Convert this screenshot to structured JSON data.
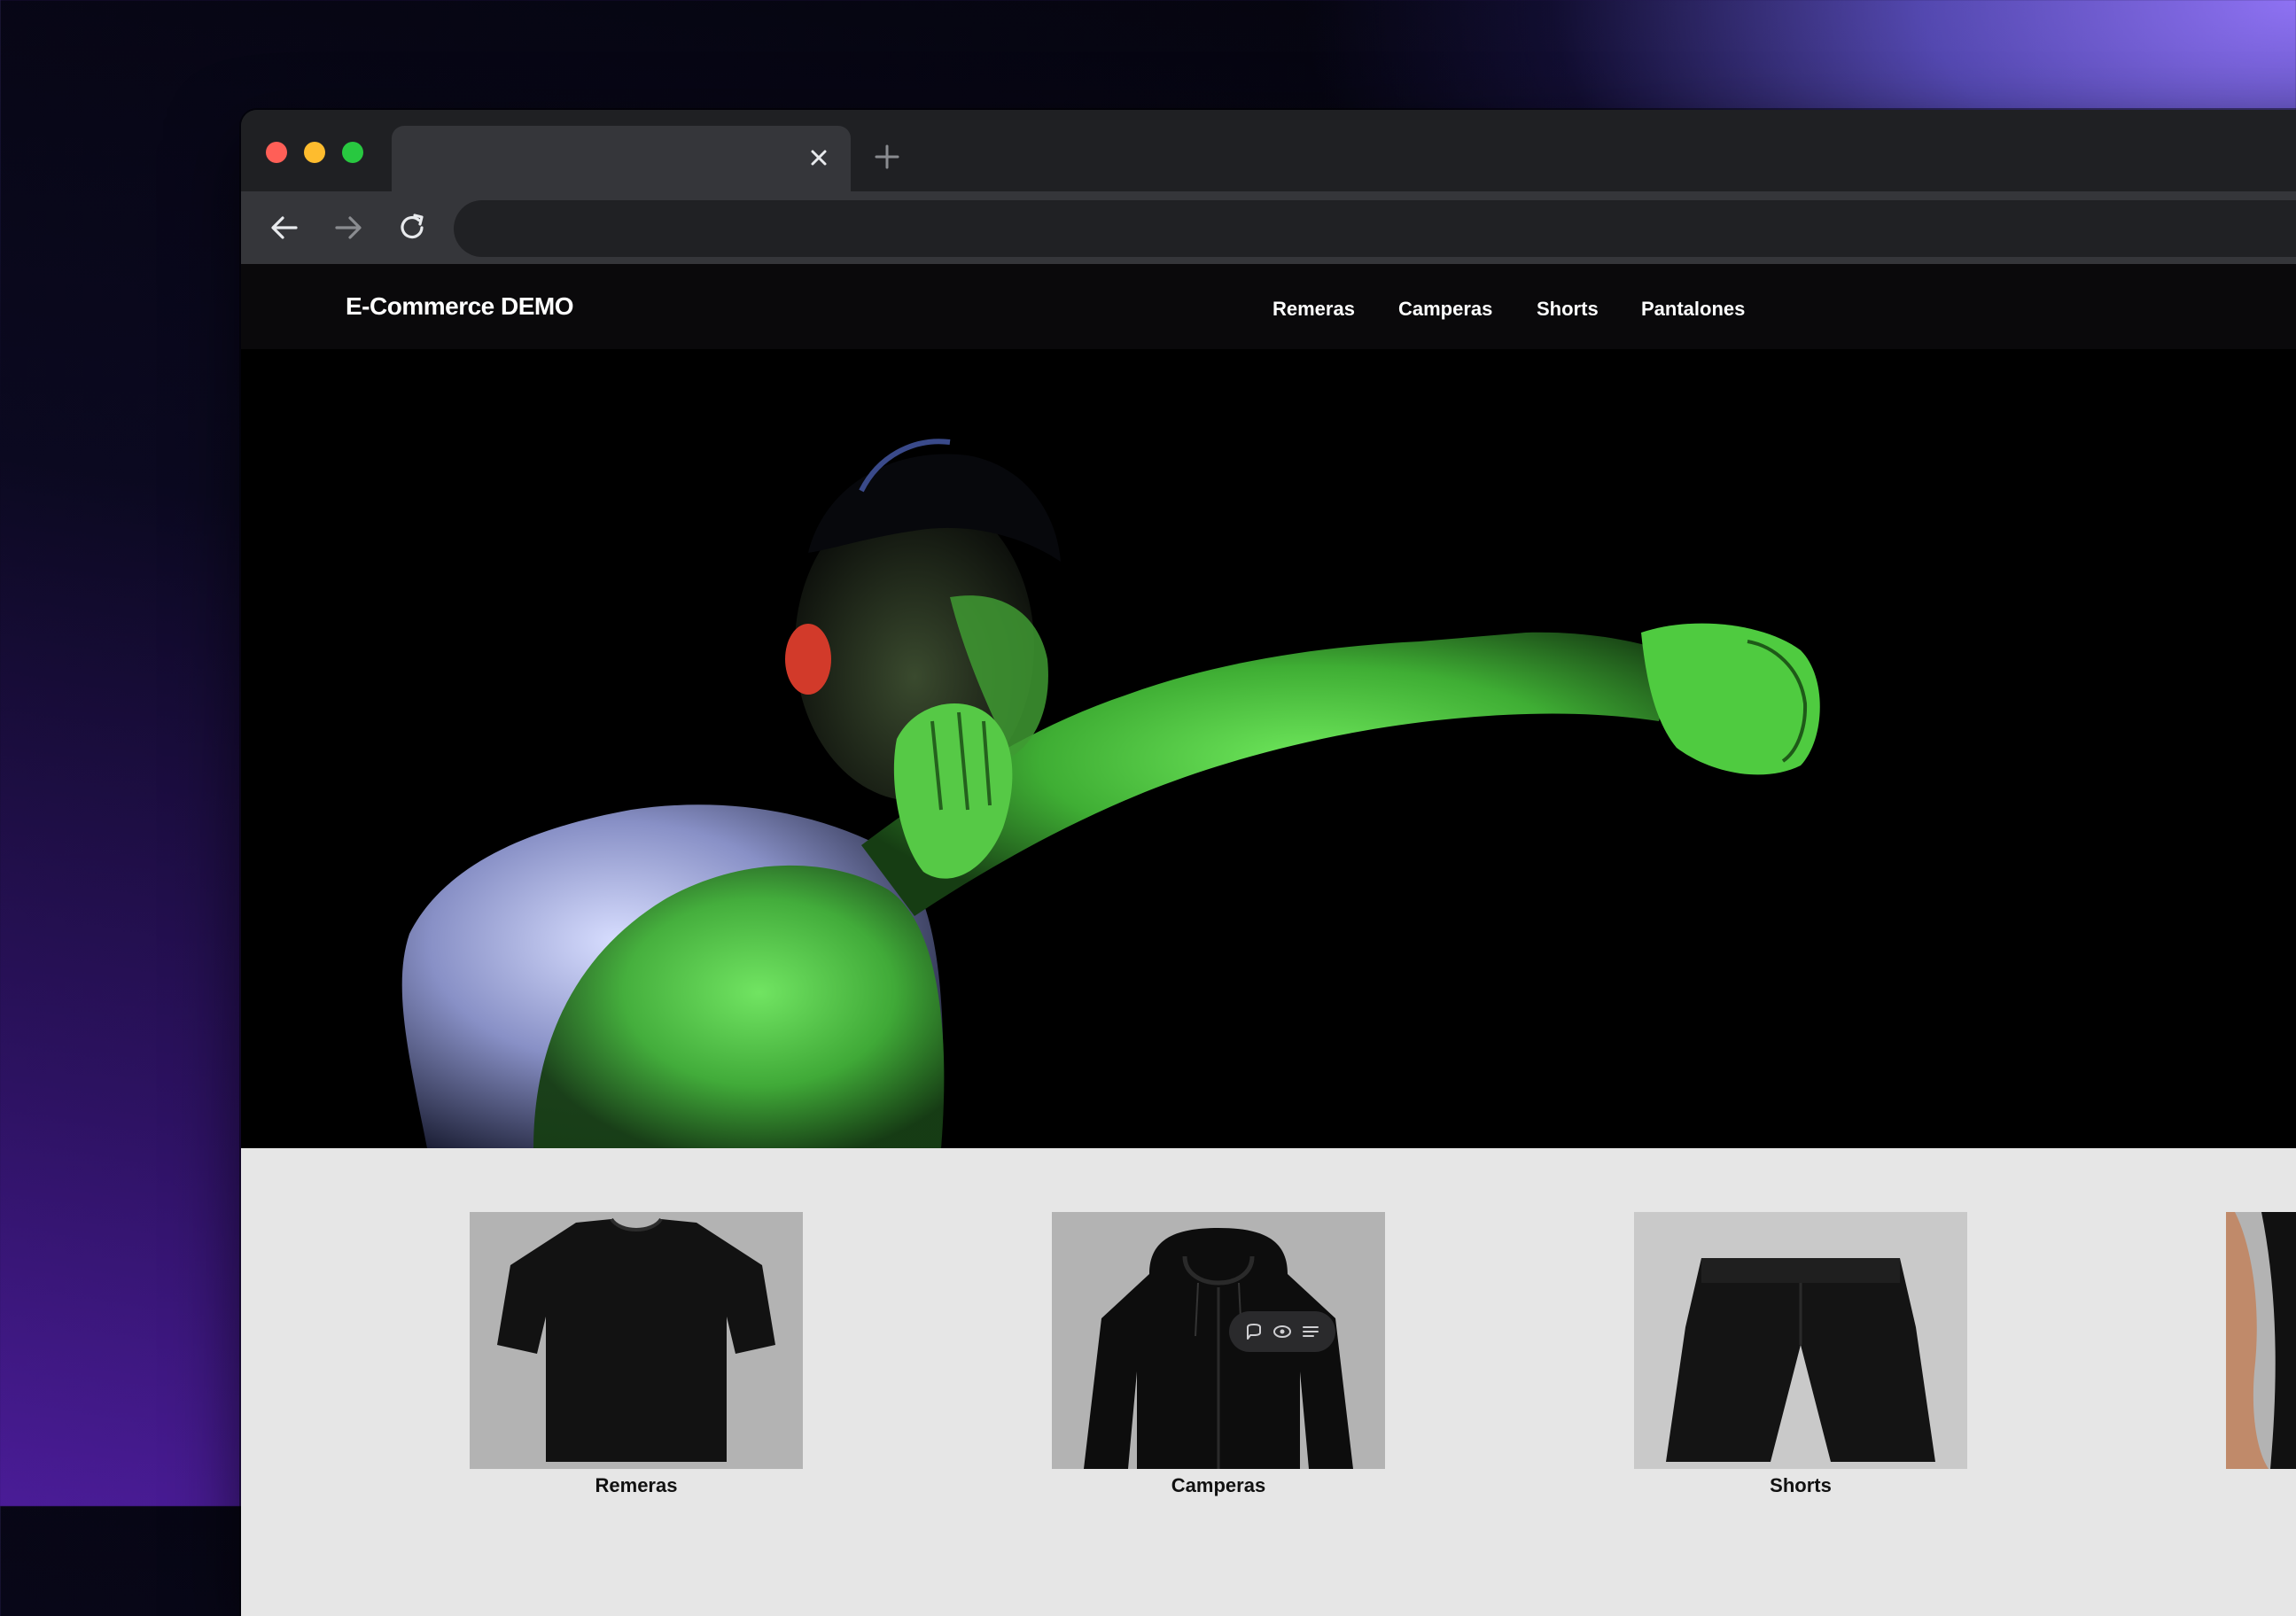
{
  "browser": {
    "tab_title": "",
    "address": ""
  },
  "site": {
    "logo": "E-Commerce DEMO",
    "nav": [
      "Remeras",
      "Camperas",
      "Shorts",
      "Pantalones"
    ]
  },
  "categories": [
    {
      "label": "Remeras"
    },
    {
      "label": "Camperas"
    },
    {
      "label": "Shorts"
    },
    {
      "label": ""
    }
  ],
  "icons": {
    "tab_close": "close-icon",
    "new_tab": "plus-icon",
    "back": "arrow-left-icon",
    "forward": "arrow-right-icon",
    "reload": "reload-icon",
    "floating": [
      "comment-icon",
      "eye-icon",
      "menu-icon"
    ]
  },
  "colors": {
    "traffic_red": "#ff5f57",
    "traffic_yellow": "#febc2e",
    "traffic_green": "#28c840",
    "hero_highlight": "#58e34a",
    "header_bg": "#0a090b",
    "section_bg": "#e6e6e6"
  }
}
